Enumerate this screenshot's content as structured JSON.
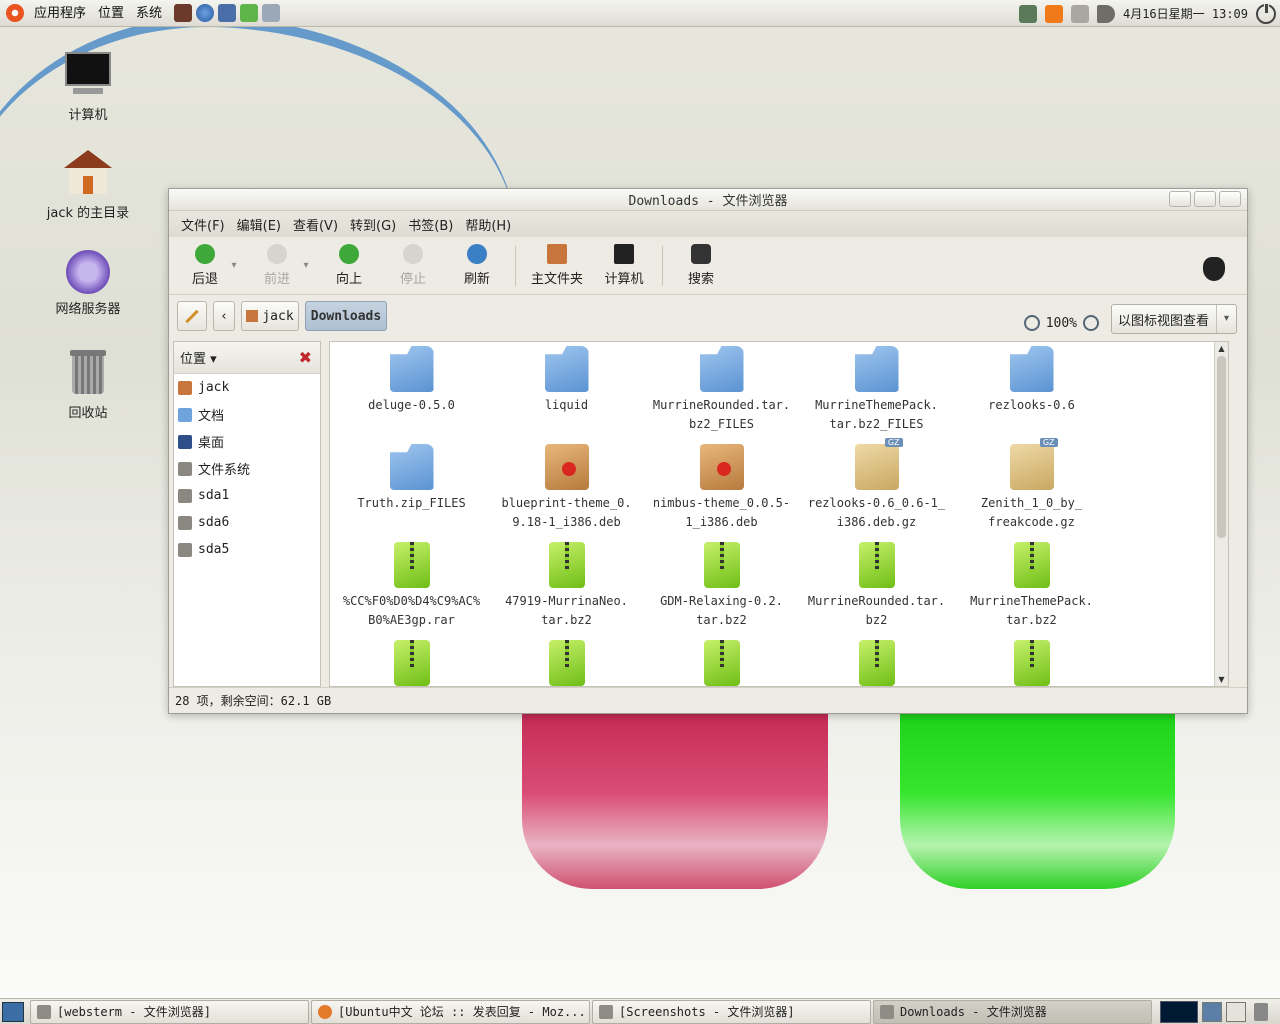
{
  "top_panel": {
    "menus": [
      "应用程序",
      "位置",
      "系统"
    ],
    "clock": "4月16日星期一 13:09"
  },
  "desktop_icons": [
    {
      "label": "计算机",
      "icon": "computer-icon"
    },
    {
      "label": "jack 的主目录",
      "icon": "home-icon"
    },
    {
      "label": "网络服务器",
      "icon": "network-icon"
    },
    {
      "label": "回收站",
      "icon": "trash-icon"
    }
  ],
  "window": {
    "title": "Downloads - 文件浏览器",
    "menu": [
      "文件(F)",
      "编辑(E)",
      "查看(V)",
      "转到(G)",
      "书签(B)",
      "帮助(H)"
    ],
    "toolbar": {
      "back": "后退",
      "forward": "前进",
      "up": "向上",
      "stop": "停止",
      "reload": "刷新",
      "home": "主文件夹",
      "computer": "计算机",
      "search": "搜索"
    },
    "path": {
      "parent": "jack",
      "current": "Downloads"
    },
    "zoom": "100%",
    "view_mode": "以图标视图查看",
    "sidebar": {
      "header": "位置",
      "items": [
        "jack",
        "文档",
        "桌面",
        "文件系统",
        "sda1",
        "sda6",
        "sda5"
      ]
    },
    "files": [
      {
        "name": "deluge-0.5.0",
        "type": "folder"
      },
      {
        "name": "liquid",
        "type": "folder"
      },
      {
        "name": "MurrineRounded.tar.\nbz2_FILES",
        "type": "folder"
      },
      {
        "name": "MurrineThemePack.\ntar.bz2_FILES",
        "type": "folder"
      },
      {
        "name": "rezlooks-0.6",
        "type": "folder"
      },
      {
        "name": "Truth.zip_FILES",
        "type": "folder"
      },
      {
        "name": "blueprint-theme_0.\n9.18-1_i386.deb",
        "type": "deb"
      },
      {
        "name": "nimbus-theme_0.0.5-\n1_i386.deb",
        "type": "deb"
      },
      {
        "name": "rezlooks-0.6_0.6-1_\ni386.deb.gz",
        "type": "gz"
      },
      {
        "name": "Zenith_1_0_by_\nfreakcode.gz",
        "type": "gz"
      },
      {
        "name": "%CC%F0%D0%D4%C9%AC%\nB0%AE3gp.rar",
        "type": "zip"
      },
      {
        "name": "47919-MurrinaNeo.\ntar.bz2",
        "type": "zip"
      },
      {
        "name": "GDM-Relaxing-0.2.\ntar.bz2",
        "type": "zip"
      },
      {
        "name": "MurrineRounded.tar.\nbz2",
        "type": "zip"
      },
      {
        "name": "MurrineThemePack.\ntar.bz2",
        "type": "zip"
      },
      {
        "name": "",
        "type": "zip"
      },
      {
        "name": "",
        "type": "zip"
      },
      {
        "name": "",
        "type": "zip"
      },
      {
        "name": "",
        "type": "zip"
      },
      {
        "name": "",
        "type": "zip"
      }
    ],
    "status": "28 项，剩余空间：62.1 GB"
  },
  "taskbar": [
    {
      "label": "[websterm - 文件浏览器]",
      "active": false
    },
    {
      "label": "[Ubuntu中文 论坛 :: 发表回复 - Moz...",
      "active": false
    },
    {
      "label": "[Screenshots - 文件浏览器]",
      "active": false
    },
    {
      "label": "Downloads - 文件浏览器",
      "active": true
    }
  ],
  "colors": {
    "accent": "#4f8dc8",
    "red_glass": "#d33a64",
    "green_glass": "#2edd26"
  }
}
